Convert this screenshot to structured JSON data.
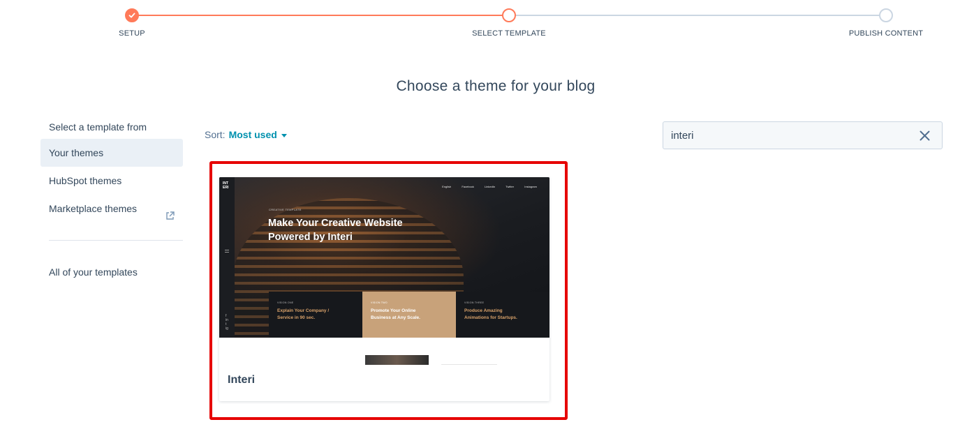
{
  "stepper": {
    "steps": [
      {
        "label": "SETUP",
        "state": "complete"
      },
      {
        "label": "SELECT TEMPLATE",
        "state": "active"
      },
      {
        "label": "PUBLISH CONTENT",
        "state": "upcoming"
      }
    ]
  },
  "colors": {
    "accent": "#ff7a59",
    "link": "#0091ae",
    "text": "#33475b",
    "highlight": "#e60000",
    "active_bg": "#eaf0f6"
  },
  "page": {
    "title": "Choose a theme for your blog"
  },
  "sidebar": {
    "heading": "Select a template from",
    "items": [
      {
        "label": "Your themes",
        "active": true
      },
      {
        "label": "HubSpot themes",
        "active": false
      },
      {
        "label": "Marketplace themes",
        "active": false,
        "icon": "external-link-icon"
      }
    ],
    "all_templates": "All of your templates"
  },
  "sort": {
    "label": "Sort:",
    "value": "Most used"
  },
  "search": {
    "value": "interi",
    "clear_icon": "close-icon"
  },
  "results": [
    {
      "name": "Interi",
      "thumbnail": {
        "logo": "INT ERI",
        "nav": [
          "English",
          "Facebook",
          "LinkedIn",
          "Twitter",
          "Instagram"
        ],
        "kicker": "CREATIVE TEMPLATE",
        "headline": "Make Your Creative Website Powered by Interi",
        "social": [
          "f",
          "in",
          "t",
          "ig"
        ],
        "boxes": [
          {
            "kicker": "VISION ONE",
            "text": "Explain Your Company / Service in 90 sec."
          },
          {
            "kicker": "VISION TWO",
            "text": "Promote Your Online Business at Any Scale."
          },
          {
            "kicker": "VISION THREE",
            "text": "Produce Amazing Animations for Startups."
          }
        ]
      }
    }
  ]
}
